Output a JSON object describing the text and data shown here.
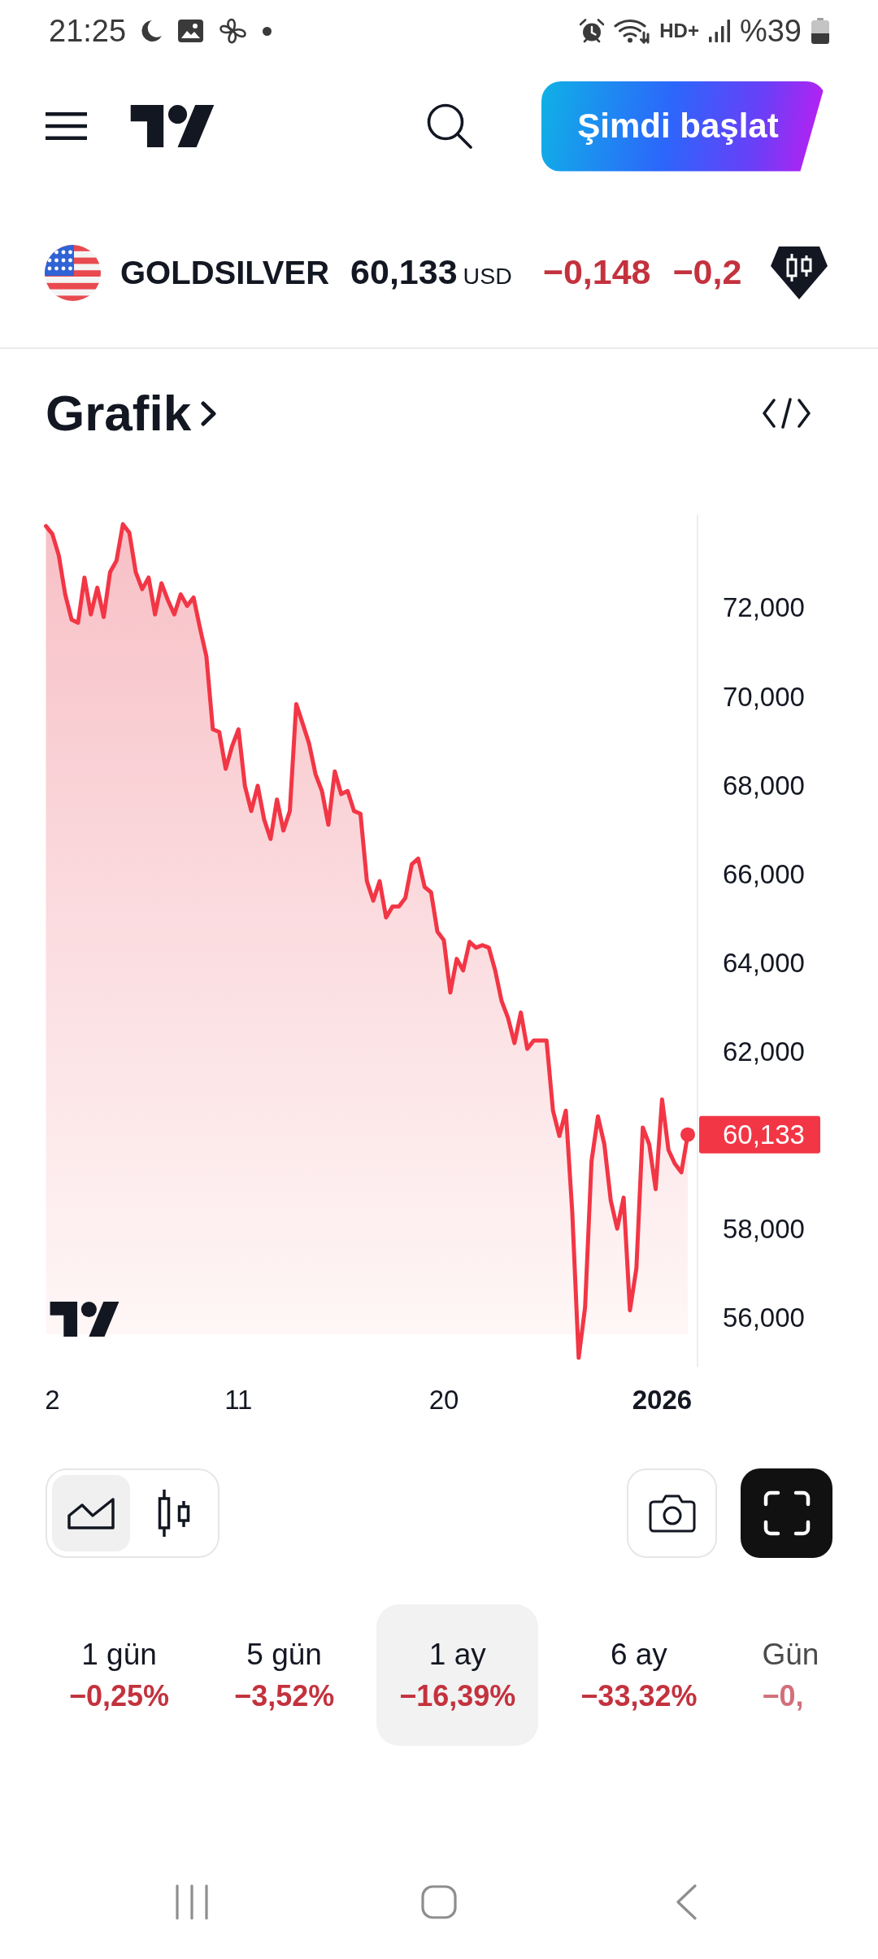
{
  "status_bar": {
    "time": "21:25",
    "network_label": "HD+",
    "battery": "%39"
  },
  "header": {
    "cta_button": "Şimdi başlat"
  },
  "symbol": {
    "ticker": "GOLDSILVER",
    "price": "60,133",
    "currency": "USD",
    "change": "−0,148",
    "change_percent": "−0,2"
  },
  "chart_section": {
    "title": "Grafik",
    "last_price_tag": "60,133",
    "chart_data": {
      "type": "area",
      "ylim": [
        54.9,
        74.1
      ],
      "categories": [
        null,
        "2",
        null,
        null,
        null,
        null,
        null,
        null,
        null,
        null,
        null,
        null,
        null,
        null,
        null,
        null,
        null,
        null,
        null,
        null,
        null,
        null,
        null,
        null,
        null,
        null,
        null,
        null,
        null,
        null,
        "11",
        null,
        null,
        null,
        null,
        null,
        null,
        null,
        null,
        null,
        null,
        null,
        null,
        null,
        null,
        null,
        null,
        null,
        null,
        null,
        null,
        null,
        null,
        null,
        null,
        null,
        null,
        null,
        null,
        null,
        null,
        null,
        "20",
        null,
        null,
        null,
        null,
        null,
        null,
        null,
        null,
        null,
        null,
        null,
        null,
        null,
        null,
        null,
        null,
        null,
        null,
        null,
        null,
        null,
        null,
        null,
        null,
        null,
        null,
        null,
        null,
        null,
        null,
        null,
        null,
        null,
        "2026",
        null,
        null,
        null,
        null
      ],
      "series": [
        {
          "color": "#f23645",
          "values": [
            73.84,
            73.66,
            73.18,
            72.3,
            71.73,
            71.66,
            72.68,
            71.85,
            72.45,
            71.79,
            72.8,
            73.06,
            73.88,
            73.69,
            72.8,
            72.42,
            72.68,
            71.85,
            72.55,
            72.17,
            71.85,
            72.3,
            72.04,
            72.23,
            71.54,
            70.9,
            69.26,
            69.2,
            68.37,
            68.88,
            69.26,
            67.99,
            67.42,
            67.99,
            67.23,
            66.79,
            67.68,
            66.98,
            67.42,
            69.83,
            69.39,
            68.94,
            68.25,
            67.87,
            67.11,
            68.31,
            67.8,
            67.87,
            67.42,
            67.36,
            65.84,
            65.4,
            65.84,
            65.02,
            65.27,
            65.27,
            65.46,
            66.22,
            66.35,
            65.71,
            65.59,
            64.7,
            64.51,
            63.33,
            64.09,
            63.83,
            64.47,
            64.34,
            64.4,
            64.34,
            63.83,
            63.14,
            62.76,
            62.19,
            62.88,
            62.06,
            62.25,
            62.25,
            62.25,
            60.67,
            60.1,
            60.67,
            58.39,
            55.1,
            56.24,
            59.53,
            60.54,
            59.91,
            58.64,
            58.01,
            58.71,
            56.17,
            57.12,
            60.29,
            59.91,
            58.9,
            60.92,
            59.78,
            59.47,
            59.28,
            60.13
          ]
        }
      ],
      "yticks": [
        {
          "value": 72,
          "label": "72,000"
        },
        {
          "value": 70,
          "label": "70,000"
        },
        {
          "value": 68,
          "label": "68,000"
        },
        {
          "value": 66,
          "label": "66,000"
        },
        {
          "value": 64,
          "label": "64,000"
        },
        {
          "value": 62,
          "label": "62,000"
        },
        {
          "value": 58,
          "label": "58,000"
        },
        {
          "value": 56,
          "label": "56,000"
        }
      ]
    }
  },
  "chart_types": [
    {
      "kind": "area",
      "selected": true
    },
    {
      "kind": "candles",
      "selected": false
    }
  ],
  "periods": [
    {
      "label": "1 gün",
      "change": "−0,25%",
      "selected": false
    },
    {
      "label": "5 gün",
      "change": "−3,52%",
      "selected": false
    },
    {
      "label": "1 ay",
      "change": "−16,39%",
      "selected": true
    },
    {
      "label": "6 ay",
      "change": "−33,32%",
      "selected": false
    },
    {
      "label": "Gün",
      "change": "−0,",
      "selected": false
    }
  ]
}
